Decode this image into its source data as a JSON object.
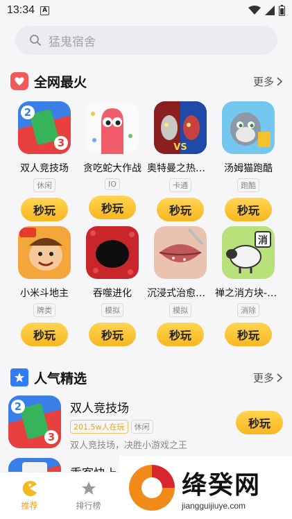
{
  "status": {
    "time": "13:34",
    "badge": "A"
  },
  "search": {
    "placeholder": "猛鬼宿舍"
  },
  "section_hot": {
    "title": "全网最火",
    "more": "更多"
  },
  "hot_games": [
    {
      "name": "双人竞技场",
      "tag": "休闲",
      "play": "秒玩"
    },
    {
      "name": "贪吃蛇大作战",
      "tag": "IO",
      "play": "秒玩"
    },
    {
      "name": "奥特曼之热血...",
      "tag": "卡通",
      "play": "秒玩"
    },
    {
      "name": "汤姆猫跑酷",
      "tag": "跑酷",
      "play": "秒玩"
    },
    {
      "name": "小米斗地主",
      "tag": "牌类",
      "play": "秒玩"
    },
    {
      "name": "吞噬进化",
      "tag": "模拟",
      "play": "秒玩"
    },
    {
      "name": "沉浸式治愈清...",
      "tag": "模拟",
      "play": "秒玩"
    },
    {
      "name": "禅之消方块-羊...",
      "tag": "消除",
      "play": "秒玩"
    }
  ],
  "section_pop": {
    "title": "人气精选",
    "more": "更多"
  },
  "pop_games": [
    {
      "name": "双人竞技场",
      "hot": "201.5w人在玩",
      "tag": "休闲",
      "desc": "双人竞技场，决胜小游戏之王",
      "play": "秒玩"
    },
    {
      "name": "乖客快上"
    }
  ],
  "nav": [
    {
      "label": "推荐",
      "active": true
    },
    {
      "label": "排行榜",
      "active": false
    }
  ],
  "watermark": {
    "big": "绛癸网",
    "small": "jiangguijiuye.com"
  },
  "colors": {
    "accent": "#f7b721",
    "hot_red": "#f25a5a",
    "pop_blue": "#2f7cf6"
  }
}
